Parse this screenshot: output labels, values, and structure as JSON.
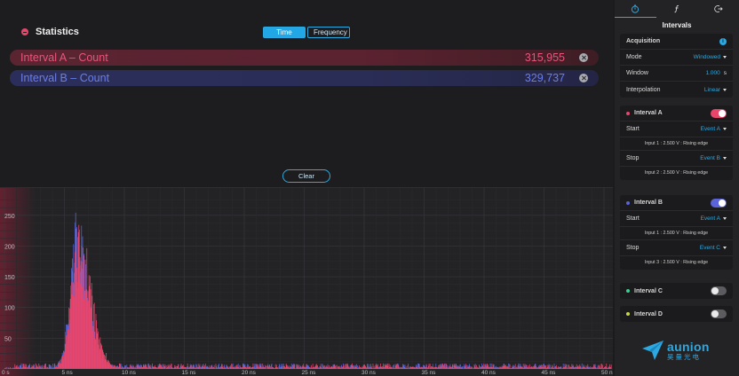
{
  "statistics": {
    "title": "Statistics",
    "view_tabs": [
      {
        "label": "Time",
        "active": true
      },
      {
        "label": "Frequency",
        "active": false
      }
    ],
    "rows": [
      {
        "label": "Interval A – Count",
        "value": "315,955",
        "color": "#e8557b"
      },
      {
        "label": "Interval B – Count",
        "value": "329,737",
        "color": "#6b7ee8"
      }
    ],
    "clear_label": "Clear"
  },
  "histogram": {
    "y_ticks": [
      "250",
      "200",
      "150",
      "100",
      "50"
    ],
    "x_ticks": [
      "0 s",
      "5 ns",
      "10 ns",
      "15 ns",
      "20 ns",
      "25 ns",
      "30 ns",
      "35 ns",
      "40 ns",
      "45 ns",
      "50 ns"
    ],
    "series_colors": {
      "a": "#e8456b",
      "b": "#5566e0"
    }
  },
  "sidebar": {
    "tabs": [
      {
        "icon": "stopwatch-icon",
        "active": true
      },
      {
        "icon": "function-icon",
        "active": false
      },
      {
        "icon": "export-icon",
        "active": false
      }
    ],
    "title": "Intervals",
    "acquisition": {
      "title": "Acquisition",
      "mode_label": "Mode",
      "mode_value": "Windowed",
      "window_label": "Window",
      "window_value": "1.000",
      "window_unit": "s",
      "interp_label": "Interpolation",
      "interp_value": "Linear"
    },
    "interval_a": {
      "title": "Interval A",
      "enabled": true,
      "color": "#e8456b",
      "start_label": "Start",
      "start_value": "Event A",
      "start_desc": "Input 1 : 2.500 V : Rising edge",
      "stop_label": "Stop",
      "stop_value": "Event B",
      "stop_desc": "Input 2 : 2.500 V : Rising edge"
    },
    "interval_b": {
      "title": "Interval B",
      "enabled": true,
      "color": "#5a63d8",
      "start_label": "Start",
      "start_value": "Event A",
      "start_desc": "Input 1 : 2.500 V : Rising edge",
      "stop_label": "Stop",
      "stop_value": "Event C",
      "stop_desc": "Input 3 : 2.500 V : Rising edge"
    },
    "interval_c": {
      "title": "Interval C",
      "enabled": false,
      "color": "#3ccf8e"
    },
    "interval_d": {
      "title": "Interval D",
      "enabled": false,
      "color": "#c8d84a"
    }
  },
  "logo": {
    "name": "aunion",
    "subtitle": "昊量光电"
  }
}
